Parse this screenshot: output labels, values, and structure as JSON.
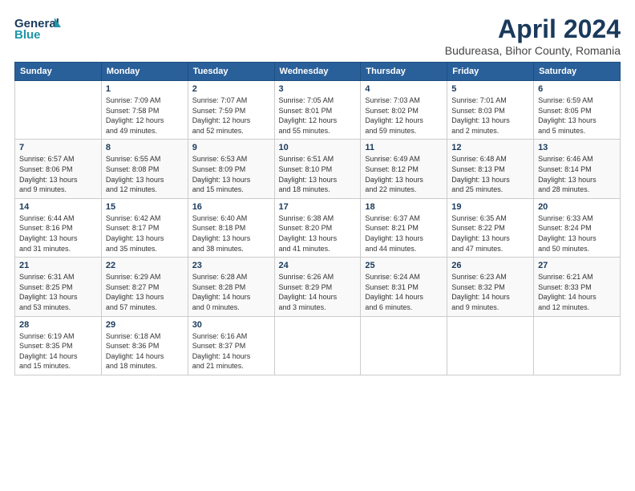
{
  "logo": {
    "line1": "General",
    "line2": "Blue"
  },
  "title": "April 2024",
  "subtitle": "Budureasa, Bihor County, Romania",
  "days_header": [
    "Sunday",
    "Monday",
    "Tuesday",
    "Wednesday",
    "Thursday",
    "Friday",
    "Saturday"
  ],
  "weeks": [
    [
      {
        "num": "",
        "info": ""
      },
      {
        "num": "1",
        "info": "Sunrise: 7:09 AM\nSunset: 7:58 PM\nDaylight: 12 hours\nand 49 minutes."
      },
      {
        "num": "2",
        "info": "Sunrise: 7:07 AM\nSunset: 7:59 PM\nDaylight: 12 hours\nand 52 minutes."
      },
      {
        "num": "3",
        "info": "Sunrise: 7:05 AM\nSunset: 8:01 PM\nDaylight: 12 hours\nand 55 minutes."
      },
      {
        "num": "4",
        "info": "Sunrise: 7:03 AM\nSunset: 8:02 PM\nDaylight: 12 hours\nand 59 minutes."
      },
      {
        "num": "5",
        "info": "Sunrise: 7:01 AM\nSunset: 8:03 PM\nDaylight: 13 hours\nand 2 minutes."
      },
      {
        "num": "6",
        "info": "Sunrise: 6:59 AM\nSunset: 8:05 PM\nDaylight: 13 hours\nand 5 minutes."
      }
    ],
    [
      {
        "num": "7",
        "info": "Sunrise: 6:57 AM\nSunset: 8:06 PM\nDaylight: 13 hours\nand 9 minutes."
      },
      {
        "num": "8",
        "info": "Sunrise: 6:55 AM\nSunset: 8:08 PM\nDaylight: 13 hours\nand 12 minutes."
      },
      {
        "num": "9",
        "info": "Sunrise: 6:53 AM\nSunset: 8:09 PM\nDaylight: 13 hours\nand 15 minutes."
      },
      {
        "num": "10",
        "info": "Sunrise: 6:51 AM\nSunset: 8:10 PM\nDaylight: 13 hours\nand 18 minutes."
      },
      {
        "num": "11",
        "info": "Sunrise: 6:49 AM\nSunset: 8:12 PM\nDaylight: 13 hours\nand 22 minutes."
      },
      {
        "num": "12",
        "info": "Sunrise: 6:48 AM\nSunset: 8:13 PM\nDaylight: 13 hours\nand 25 minutes."
      },
      {
        "num": "13",
        "info": "Sunrise: 6:46 AM\nSunset: 8:14 PM\nDaylight: 13 hours\nand 28 minutes."
      }
    ],
    [
      {
        "num": "14",
        "info": "Sunrise: 6:44 AM\nSunset: 8:16 PM\nDaylight: 13 hours\nand 31 minutes."
      },
      {
        "num": "15",
        "info": "Sunrise: 6:42 AM\nSunset: 8:17 PM\nDaylight: 13 hours\nand 35 minutes."
      },
      {
        "num": "16",
        "info": "Sunrise: 6:40 AM\nSunset: 8:18 PM\nDaylight: 13 hours\nand 38 minutes."
      },
      {
        "num": "17",
        "info": "Sunrise: 6:38 AM\nSunset: 8:20 PM\nDaylight: 13 hours\nand 41 minutes."
      },
      {
        "num": "18",
        "info": "Sunrise: 6:37 AM\nSunset: 8:21 PM\nDaylight: 13 hours\nand 44 minutes."
      },
      {
        "num": "19",
        "info": "Sunrise: 6:35 AM\nSunset: 8:22 PM\nDaylight: 13 hours\nand 47 minutes."
      },
      {
        "num": "20",
        "info": "Sunrise: 6:33 AM\nSunset: 8:24 PM\nDaylight: 13 hours\nand 50 minutes."
      }
    ],
    [
      {
        "num": "21",
        "info": "Sunrise: 6:31 AM\nSunset: 8:25 PM\nDaylight: 13 hours\nand 53 minutes."
      },
      {
        "num": "22",
        "info": "Sunrise: 6:29 AM\nSunset: 8:27 PM\nDaylight: 13 hours\nand 57 minutes."
      },
      {
        "num": "23",
        "info": "Sunrise: 6:28 AM\nSunset: 8:28 PM\nDaylight: 14 hours\nand 0 minutes."
      },
      {
        "num": "24",
        "info": "Sunrise: 6:26 AM\nSunset: 8:29 PM\nDaylight: 14 hours\nand 3 minutes."
      },
      {
        "num": "25",
        "info": "Sunrise: 6:24 AM\nSunset: 8:31 PM\nDaylight: 14 hours\nand 6 minutes."
      },
      {
        "num": "26",
        "info": "Sunrise: 6:23 AM\nSunset: 8:32 PM\nDaylight: 14 hours\nand 9 minutes."
      },
      {
        "num": "27",
        "info": "Sunrise: 6:21 AM\nSunset: 8:33 PM\nDaylight: 14 hours\nand 12 minutes."
      }
    ],
    [
      {
        "num": "28",
        "info": "Sunrise: 6:19 AM\nSunset: 8:35 PM\nDaylight: 14 hours\nand 15 minutes."
      },
      {
        "num": "29",
        "info": "Sunrise: 6:18 AM\nSunset: 8:36 PM\nDaylight: 14 hours\nand 18 minutes."
      },
      {
        "num": "30",
        "info": "Sunrise: 6:16 AM\nSunset: 8:37 PM\nDaylight: 14 hours\nand 21 minutes."
      },
      {
        "num": "",
        "info": ""
      },
      {
        "num": "",
        "info": ""
      },
      {
        "num": "",
        "info": ""
      },
      {
        "num": "",
        "info": ""
      }
    ]
  ]
}
